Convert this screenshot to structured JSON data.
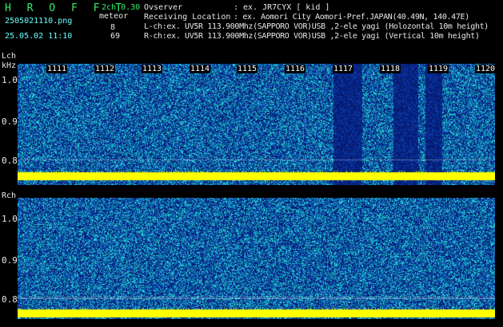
{
  "header": {
    "app_title": "H R O F F T",
    "mode": "2ch 0.30",
    "filename": "2505021110.png",
    "counter_label": "meteor",
    "datetime": "25.05.02 11:10",
    "lch_count": "8",
    "rch_count": "69",
    "observer_label": "Ovserver",
    "observer_value": ": ex. JR7CYX [ kid ]",
    "location_label": "Receiving Location",
    "location_value": ": ex. Aomori City Aomori-Pref.JAPAN(40.49N, 140.47E)",
    "lch_info": "L-ch:ex. UV5R 113.900Mhz(SAPPORO VOR)USB ,2-ele yagi (Holozontal 10m height)",
    "rch_info": "R-ch:ex. UV5R 113.900Mhz(SAPPORO VOR)USB ,2-ele yagi (Vertical 10m height)"
  },
  "lch": {
    "label": "Lch",
    "unit": "kHz",
    "yticks": [
      "1.0",
      "0.9",
      "0.8"
    ],
    "time_ticks": [
      "1111",
      "1112",
      "1113",
      "1114",
      "1115",
      "1116",
      "1117",
      "1118",
      "1119",
      "1120"
    ]
  },
  "rch": {
    "label": "Rch",
    "yticks": [
      "1.0",
      "0.9",
      "0.8"
    ]
  },
  "colors": {
    "header_green": "#33ee66",
    "header_cyan": "#66ffff",
    "carrier_yellow": "#ffff00",
    "noise_blue": "#0a2a9a",
    "noise_cyan": "#22c8d8"
  }
}
